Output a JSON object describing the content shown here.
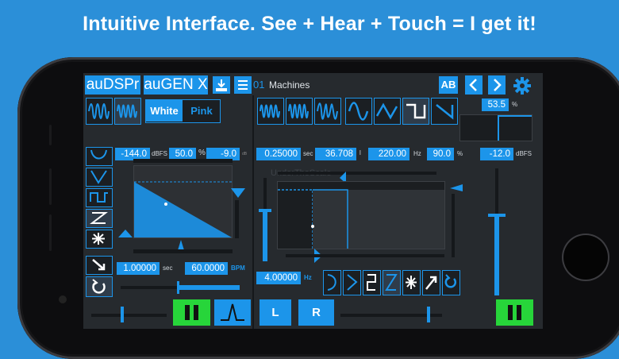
{
  "headline": "Intuitive Interface.  See + Hear + Touch = I get it!",
  "header": {
    "tab_audspr": "auDSPr",
    "tab_augen": "auGEN X",
    "preset_number": "01",
    "preset_name": "Machines",
    "ab_label": "AB",
    "prev_icon": "chevron-left-icon",
    "next_icon": "chevron-right-icon",
    "settings_icon": "gear-icon"
  },
  "noise": {
    "white_label": "White",
    "pink_label": "Pink",
    "selected": "White"
  },
  "envelope": {
    "level_db": "-144.0",
    "level_unit": "dBFS",
    "shape_pct": "50.0",
    "shape_unit": "%",
    "third_value": "-9.0",
    "third_unit": "dB",
    "period_sec": "1.00000",
    "period_unit": "sec",
    "bpm": "60.0000",
    "bpm_unit": "BPM"
  },
  "oscillator": {
    "duration_sec": "0.25000",
    "duration_unit": "sec",
    "ms_value": "36.708",
    "ms_unit": "l",
    "freq_hz": "220.00",
    "freq_unit": "Hz",
    "duty_pct": "90.0",
    "duty_unit": "%",
    "level_db": "-12.0",
    "level_unit": "dBFS",
    "pwm_pct": "53.5",
    "pwm_unit": "%",
    "rate_hz": "4.00000",
    "rate_unit": "Hz",
    "watermark": "UnderTheScale"
  },
  "channels": {
    "left_label": "L",
    "right_label": "R"
  },
  "colors": {
    "accent": "#1c95ea",
    "play_green": "#27d53a",
    "background": "#2b8fd8",
    "screen": "#262a2e"
  }
}
